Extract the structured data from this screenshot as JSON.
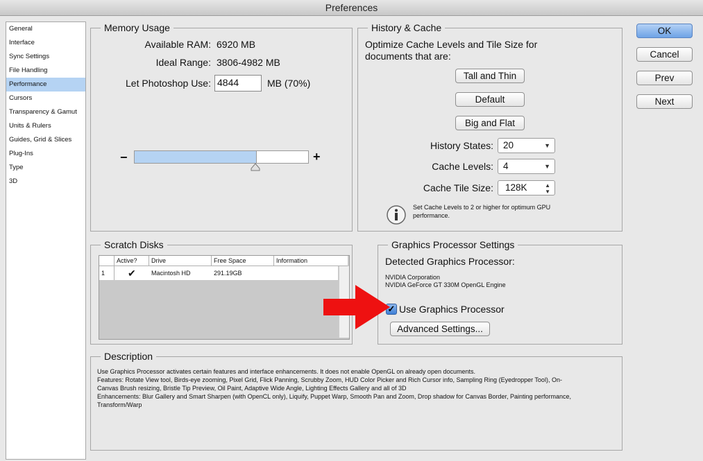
{
  "window": {
    "title": "Preferences"
  },
  "sidebar": {
    "items": [
      {
        "label": "General"
      },
      {
        "label": "Interface"
      },
      {
        "label": "Sync Settings"
      },
      {
        "label": "File Handling"
      },
      {
        "label": "Performance",
        "selected": true
      },
      {
        "label": "Cursors"
      },
      {
        "label": "Transparency & Gamut"
      },
      {
        "label": "Units & Rulers"
      },
      {
        "label": "Guides, Grid & Slices"
      },
      {
        "label": "Plug-Ins"
      },
      {
        "label": "Type"
      },
      {
        "label": "3D"
      }
    ]
  },
  "memory": {
    "title": "Memory Usage",
    "available_label": "Available RAM:",
    "available_value": "6920 MB",
    "ideal_label": "Ideal Range:",
    "ideal_value": "3806-4982 MB",
    "let_label": "Let Photoshop Use:",
    "let_value": "4844",
    "let_unit": "MB (70%)",
    "minus": "−",
    "plus": "+",
    "slider_fraction": 0.7
  },
  "history": {
    "title": "History & Cache",
    "desc": "Optimize Cache Levels and Tile Size for documents that are:",
    "btn_tall": "Tall and Thin",
    "btn_default": "Default",
    "btn_big": "Big and Flat",
    "states_label": "History States:",
    "states_value": "20",
    "levels_label": "Cache Levels:",
    "levels_value": "4",
    "tile_label": "Cache Tile Size:",
    "tile_value": "128K",
    "info_text": "Set Cache Levels to 2 or higher for optimum GPU performance."
  },
  "scratch": {
    "title": "Scratch Disks",
    "headers": [
      "",
      "Active?",
      "Drive",
      "Free Space",
      "Information"
    ],
    "rows": [
      {
        "num": "1",
        "active": true,
        "drive": "Macintosh HD",
        "free": "291.19GB",
        "info": ""
      }
    ]
  },
  "gpu": {
    "title": "Graphics Processor Settings",
    "detected_label": "Detected Graphics Processor:",
    "vendor": "NVIDIA Corporation",
    "model": "NVIDIA GeForce GT 330M OpenGL Engine",
    "use_label": "Use Graphics Processor",
    "use_checked": true,
    "advanced": "Advanced Settings..."
  },
  "description": {
    "title": "Description",
    "line1": "Use Graphics Processor activates certain features and interface enhancements. It does not enable OpenGL on already open documents.",
    "line2": "Features: Rotate View tool, Birds-eye zooming, Pixel Grid, Flick Panning, Scrubby Zoom, HUD Color Picker and Rich Cursor info, Sampling Ring (Eyedropper Tool), On-",
    "line3": "Canvas Brush resizing, Bristle Tip Preview, Oil Paint, Adaptive Wide Angle, Lighting Effects Gallery and all of 3D",
    "line4": "Enhancements: Blur Gallery and Smart Sharpen (with OpenCL only), Liquify, Puppet Warp, Smooth Pan and Zoom, Drop shadow for Canvas Border, Painting performance,",
    "line5": "Transform/Warp"
  },
  "buttons": {
    "ok": "OK",
    "cancel": "Cancel",
    "prev": "Prev",
    "next": "Next"
  },
  "colors": {
    "accent": "#b5d3f3",
    "default_button": "#6ea3e6",
    "arrow": "#ee1111"
  }
}
